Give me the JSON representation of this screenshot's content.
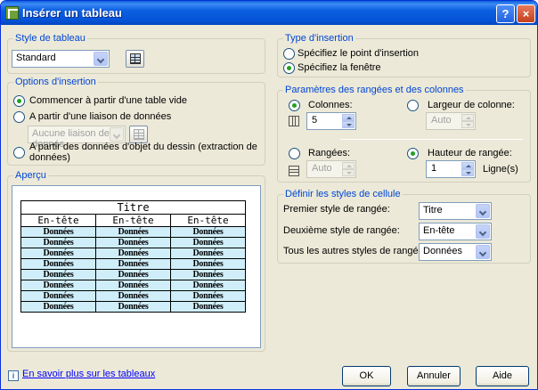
{
  "window": {
    "title": "Insérer un tableau",
    "help_glyph": "?",
    "close_glyph": "×"
  },
  "style": {
    "legend": "Style de tableau",
    "selected": "Standard"
  },
  "insert_options": {
    "legend": "Options d'insertion",
    "opt1": "Commencer à partir d'une table vide",
    "opt2": "A partir d'une liaison de données",
    "link_placeholder": "Aucune liaison de donnés",
    "opt3_line1": "A partir des données d'objet du dessin (extraction de",
    "opt3_line2": "données)"
  },
  "preview": {
    "legend": "Aperçu",
    "title": "Titre",
    "headers": [
      "En-tête",
      "En-tête",
      "En-tête"
    ],
    "cell": "Données",
    "row_count": 8
  },
  "insertion_type": {
    "legend": "Type d'insertion",
    "opt1": "Spécifiez le point d'insertion",
    "opt2": "Spécifiez la fenêtre"
  },
  "params": {
    "legend": "Paramètres des rangées et des colonnes",
    "columns_label": "Colonnes:",
    "columns_value": "5",
    "col_width_label": "Largeur de colonne:",
    "col_width_value": "Auto",
    "rows_label": "Rangées:",
    "rows_value": "Auto",
    "row_height_label": "Hauteur de rangée:",
    "row_height_value": "1",
    "row_height_unit": "Ligne(s)"
  },
  "cell_styles": {
    "legend": "Définir les styles de cellule",
    "first_label": "Premier style de rangée:",
    "first_value": "Titre",
    "second_label": "Deuxième style de rangée:",
    "second_value": "En-tête",
    "others_label": "Tous les autres styles de rangée:",
    "others_value": "Données"
  },
  "footer": {
    "info_glyph": "i",
    "link": "En savoir plus sur les tableaux",
    "ok": "OK",
    "cancel": "Annuler",
    "help": "Aide"
  }
}
